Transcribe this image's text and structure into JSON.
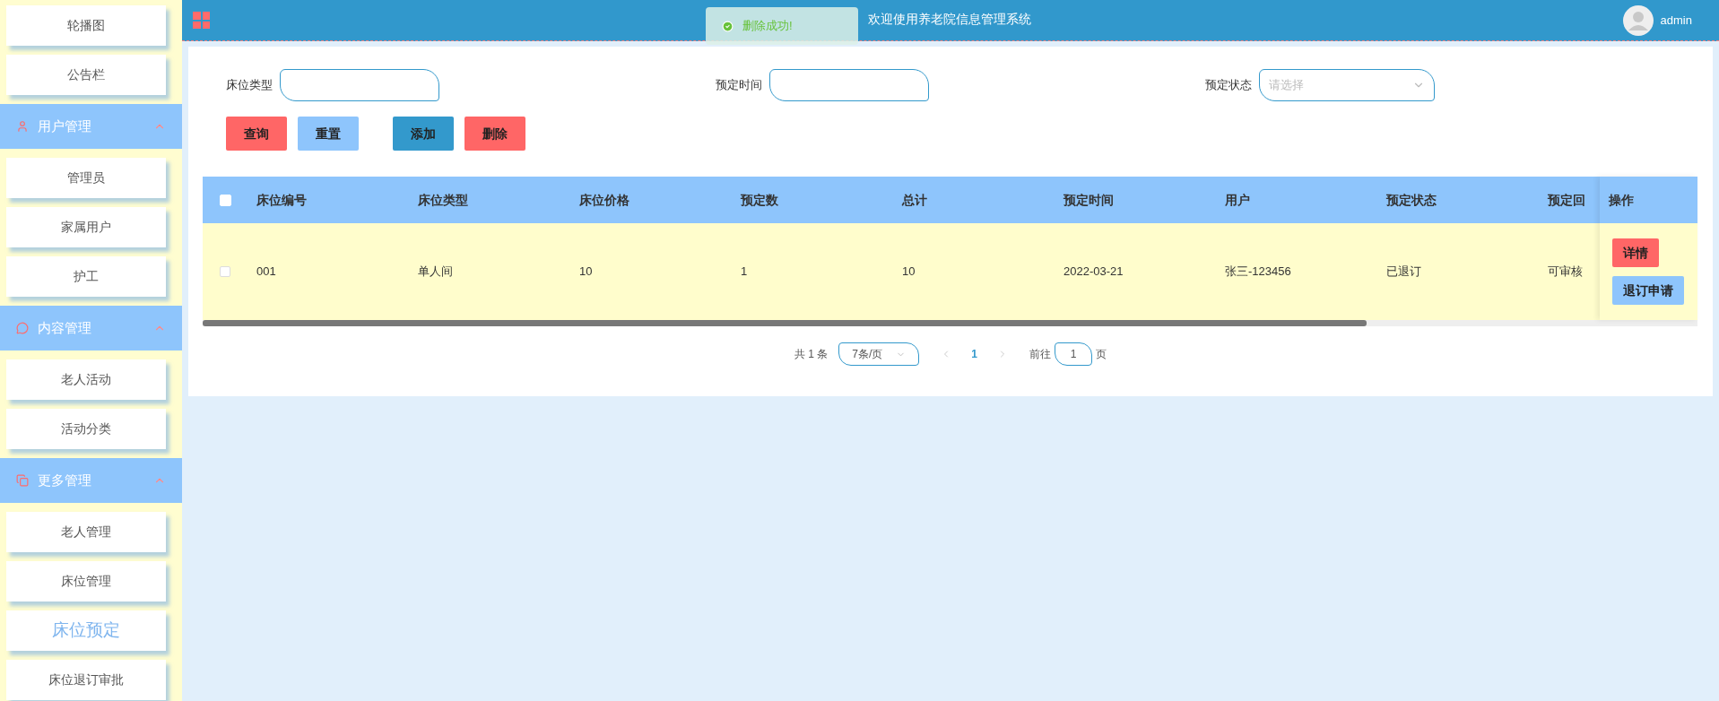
{
  "sidebar": {
    "items": [
      {
        "kind": "item",
        "label": "轮播图",
        "selected": false
      },
      {
        "kind": "item",
        "label": "公告栏",
        "selected": false
      },
      {
        "kind": "group",
        "label": "用户管理",
        "expanded": true
      },
      {
        "kind": "item",
        "label": "管理员",
        "selected": false
      },
      {
        "kind": "item",
        "label": "家属用户",
        "selected": false
      },
      {
        "kind": "item",
        "label": "护工",
        "selected": false
      },
      {
        "kind": "group",
        "label": "内容管理",
        "expanded": true
      },
      {
        "kind": "item",
        "label": "老人活动",
        "selected": false
      },
      {
        "kind": "item",
        "label": "活动分类",
        "selected": false
      },
      {
        "kind": "group",
        "label": "更多管理",
        "expanded": true
      },
      {
        "kind": "item",
        "label": "老人管理",
        "selected": false
      },
      {
        "kind": "item",
        "label": "床位管理",
        "selected": false
      },
      {
        "kind": "item",
        "label": "床位预定",
        "selected": true
      },
      {
        "kind": "item",
        "label": "床位退订审批",
        "selected": false
      }
    ]
  },
  "header": {
    "title": "欢迎使用养老院信息管理系统",
    "user": "admin"
  },
  "toast": {
    "text": "删除成功!"
  },
  "filters": [
    {
      "kind": "input",
      "label": "床位类型"
    },
    {
      "kind": "input",
      "label": "预定时间"
    },
    {
      "kind": "select",
      "label": "预定状态",
      "placeholder": "请选择"
    }
  ],
  "buttons": [
    {
      "label": "查询",
      "color": "#ff6666"
    },
    {
      "label": "重置",
      "color": "#8ec5fc"
    },
    {
      "label": "添加",
      "color": "#3399cc"
    },
    {
      "label": "删除",
      "color": "#ff6666"
    }
  ],
  "table": {
    "all_checked": false,
    "columns": [
      "床位编号",
      "床位类型",
      "床位价格",
      "预定数",
      "总计",
      "预定时间",
      "用户",
      "预定状态",
      "预定回"
    ],
    "action_column": "操作",
    "rows": [
      {
        "checked": false,
        "cells": [
          "001",
          "单人间",
          "10",
          "1",
          "10",
          "2022-03-21",
          "张三-123456",
          "已退订",
          "可审核"
        ],
        "actions": [
          {
            "label": "详情",
            "color": "#ff6666"
          },
          {
            "label": "退订申请",
            "color": "#8ec5fc"
          }
        ]
      }
    ]
  },
  "pagination": {
    "total": "共 1 条",
    "page_size": "7条/页",
    "pages": [
      {
        "label": "1",
        "selected": true
      }
    ],
    "goto": "前往",
    "page_input": "1",
    "page_unit": "页"
  }
}
